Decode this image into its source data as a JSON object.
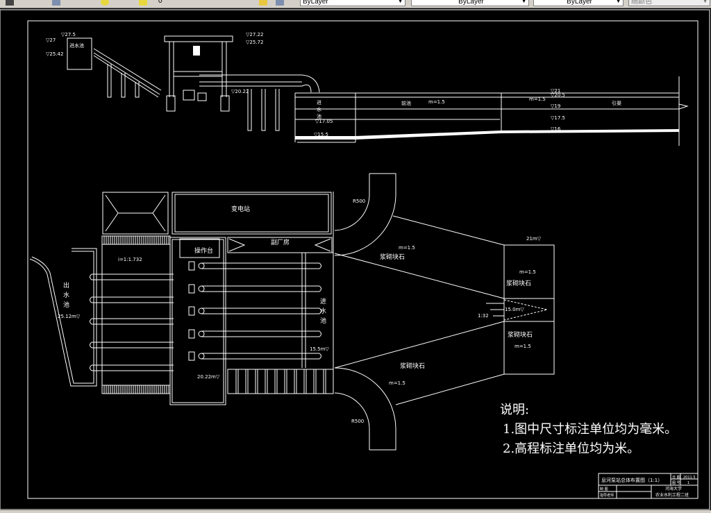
{
  "toolbar": {
    "layer_value": "0",
    "color_value": "ByLayer",
    "linetype_value": "ByLayer",
    "lineweight_value": "ByLayer",
    "plotstyle_value": "随颜色",
    "icons": [
      "layer-manager-icon",
      "layer-state-icon",
      "make-current-icon",
      "layer-previous-icon"
    ]
  },
  "profile": {
    "elev_275": "▽27.5",
    "elev_27": "▽27",
    "elev_2542": "▽25.42",
    "inlet_label": "进水池",
    "elev_2722": "▽27.22",
    "elev_2572": "▽25.72",
    "elev_2022": "▽20.22",
    "pool_label": [
      "进",
      "水",
      "池"
    ],
    "elev_1705": "▽17.05",
    "elev_155": "▽15.5",
    "forebay": "前池",
    "m1": "m=1.5",
    "m2": "m=1.5",
    "canal": "引渠",
    "e21": "▽21",
    "e205": "▽20.5",
    "e19": "▽19",
    "e175": "▽17.5",
    "e16": "▽16"
  },
  "plan": {
    "substation": "变电站",
    "console": "操作台",
    "aux_building": "副厂房",
    "outlet_pool": [
      "出",
      "水",
      "池"
    ],
    "outlet_elev": "25.12m▽",
    "slope": "i=1:1.732",
    "intake_pool": [
      "进",
      "水",
      "池"
    ],
    "intake_elev": "15.5m▽",
    "floor_elev": "20.22m▽",
    "r_top": "R500",
    "r_bottom": "R500",
    "m_a": "m=1.5",
    "stone_a": "浆砌块石",
    "m_b": "m=1.5",
    "stone_b": "浆砌块石",
    "stone_c": "浆砌块石",
    "m_c": "m=1.5",
    "stone_d": "浆砌块石",
    "m_d": "m=1.5",
    "elev_21": "21m▽",
    "elev_15": "15.0m▽",
    "ratio": "1:32"
  },
  "notes": {
    "title": "说明:",
    "items": [
      "1.图中尺寸标注单位均为毫米。",
      "2.高程标注单位均为米。"
    ]
  },
  "title_block": {
    "drawing_title": "息河泵站总体布置图（1:1）",
    "date_label": "日 期",
    "date_value": "2011.5",
    "number_label": "图 号",
    "number_value": "1",
    "drawn_by": "制 图",
    "advisor": "指导老师",
    "school": "河海大学",
    "class": "农业水利工程二班"
  }
}
